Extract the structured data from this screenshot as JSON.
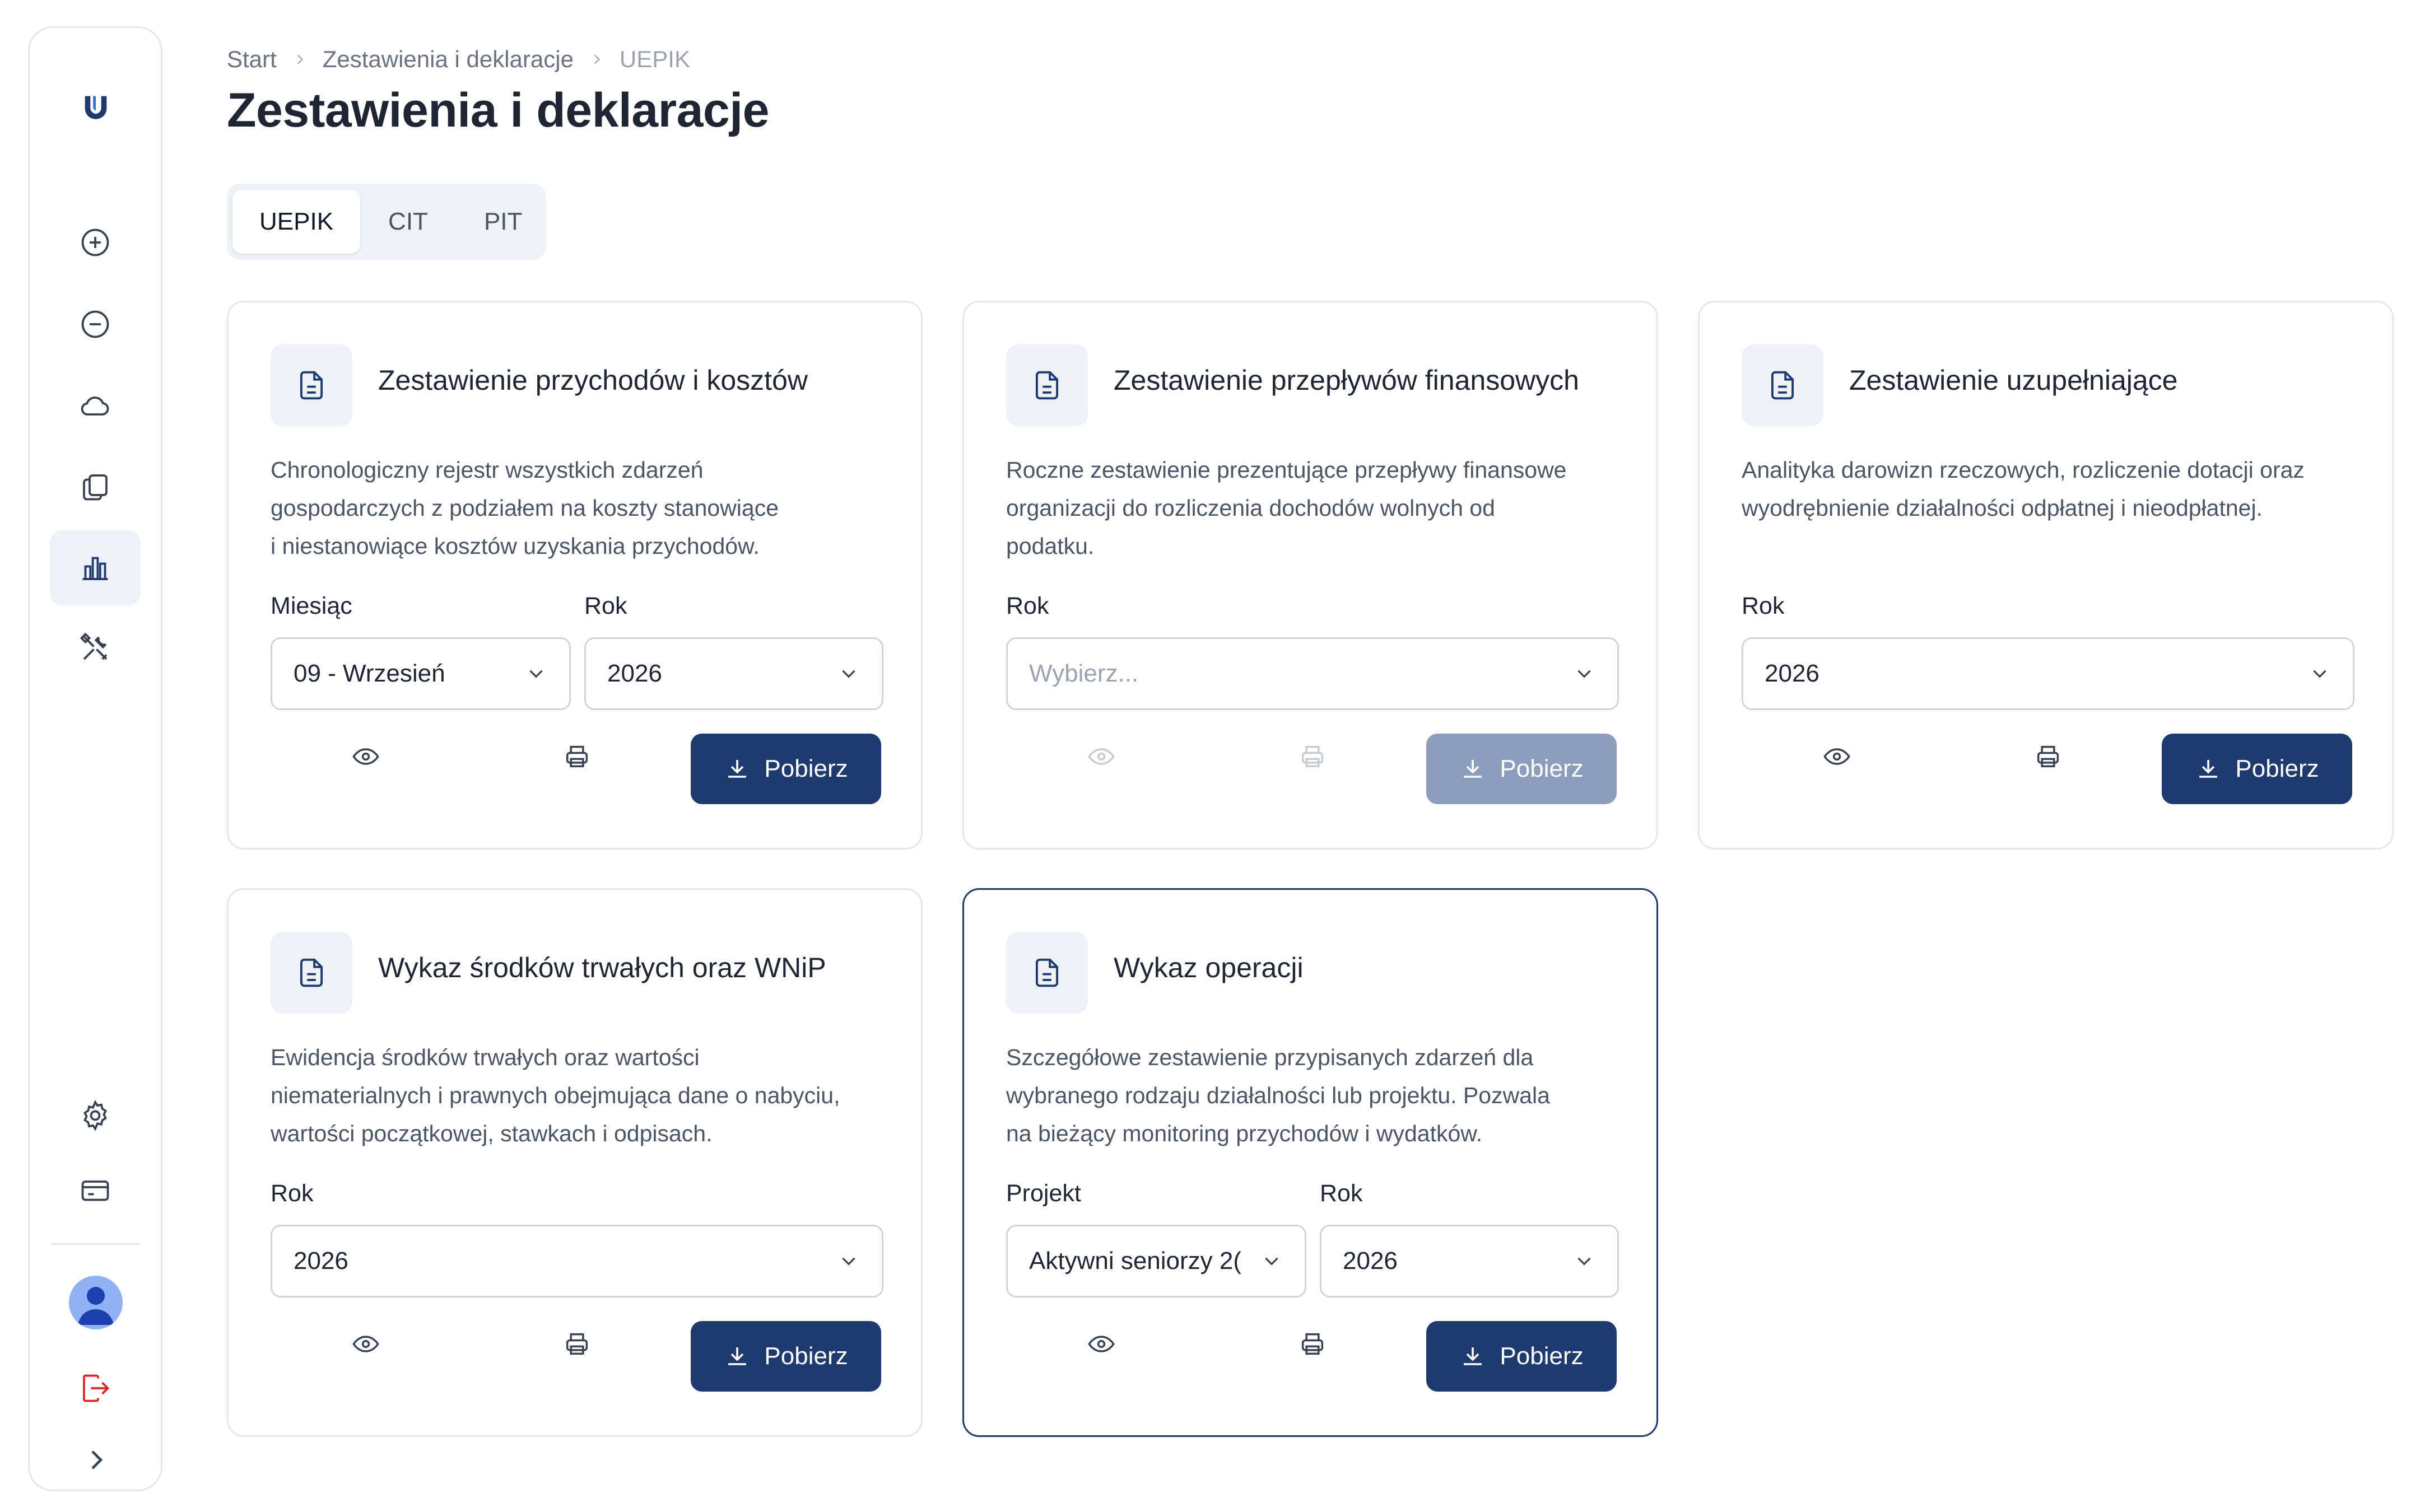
{
  "breadcrumb": {
    "items": [
      "Start",
      "Zestawienia i deklaracje"
    ],
    "current": "UEPIK"
  },
  "page": {
    "title": "Zestawienia i deklaracje"
  },
  "tabs": [
    {
      "label": "UEPIK",
      "active": true
    },
    {
      "label": "CIT",
      "active": false
    },
    {
      "label": "PIT",
      "active": false
    }
  ],
  "sidebar": {
    "logo": "brand-logo-icon",
    "items": [
      {
        "icon": "plus-circle-icon"
      },
      {
        "icon": "minus-circle-icon"
      },
      {
        "icon": "cloud-icon"
      },
      {
        "icon": "documents-icon"
      },
      {
        "icon": "bar-chart-icon",
        "active": true
      },
      {
        "icon": "tools-icon"
      }
    ],
    "bottom": [
      {
        "icon": "settings-icon"
      },
      {
        "icon": "card-icon"
      },
      {
        "icon": "avatar"
      },
      {
        "icon": "logout-icon"
      },
      {
        "icon": "chevron-right-icon"
      }
    ]
  },
  "cards": {
    "c1": {
      "title": "Zestawienie przychodów i kosztów",
      "desc_lines": [
        "Chronologiczny rejestr wszystkich zdarzeń",
        "gospodarczych z podziałem na koszty stanowiące",
        "i niestanowiące kosztów uzyskania przychodów."
      ],
      "field1_label": "Miesiąc",
      "field1_value": "09 - Wrzesień",
      "field2_label": "Rok",
      "field2_value": "2026",
      "button": "Pobierz"
    },
    "c2": {
      "title": "Zestawienie przepływów finansowych",
      "desc_lines": [
        "Roczne zestawienie prezentujące przepływy finansowe",
        "organizacji do rozliczenia dochodów wolnych od",
        "podatku."
      ],
      "field1_label": "Rok",
      "field1_placeholder": "Wybierz...",
      "button": "Pobierz"
    },
    "c3": {
      "title": "Zestawienie uzupełniające",
      "desc_lines": [
        "Analityka darowizn rzeczowych, rozliczenie dotacji oraz",
        "wyodrębnienie działalności odpłatnej i nieodpłatnej."
      ],
      "field1_label": "Rok",
      "field1_value": "2026",
      "button": "Pobierz"
    },
    "c4": {
      "title": "Wykaz środków trwałych oraz WNiP",
      "desc_lines": [
        "Ewidencja środków trwałych oraz wartości",
        "niematerialnych i prawnych obejmująca dane o nabyciu,",
        "wartości początkowej, stawkach i odpisach."
      ],
      "field1_label": "Rok",
      "field1_value": "2026",
      "button": "Pobierz"
    },
    "c5": {
      "title": "Wykaz operacji",
      "desc_lines": [
        "Szczegółowe zestawienie przypisanych zdarzeń dla",
        "wybranego rodzaju działalności lub projektu. Pozwala",
        "na bieżący monitoring przychodów i wydatków."
      ],
      "field1_label": "Projekt",
      "field1_value": "Aktywni seniorzy 2(",
      "field2_label": "Rok",
      "field2_value": "2026",
      "button": "Pobierz"
    }
  },
  "colors": {
    "primary": "#1e3a6e",
    "primary_disabled": "#8d9ebd",
    "icon_bg": "#eef1f6",
    "logout": "#dc2626"
  }
}
